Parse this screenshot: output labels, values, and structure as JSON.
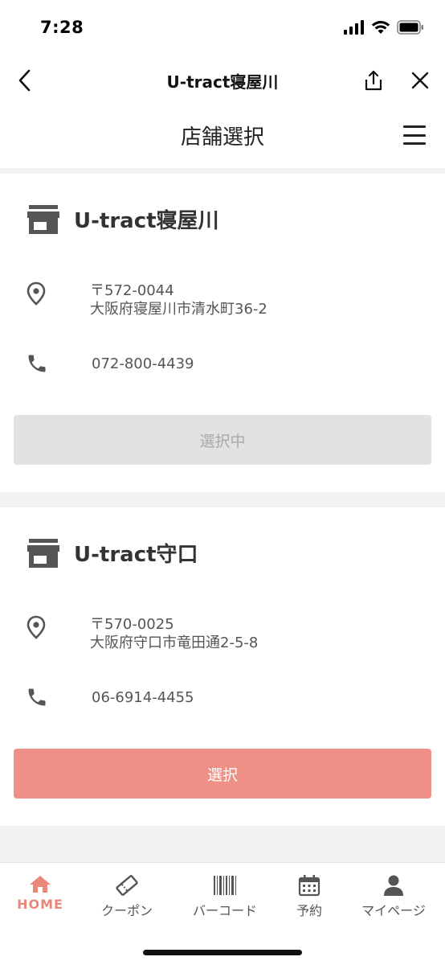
{
  "status_bar": {
    "time": "7:28"
  },
  "browser": {
    "title": "U-tract寝屋川"
  },
  "page": {
    "title": "店舗選択"
  },
  "stores": [
    {
      "name": "U-tract寝屋川",
      "postal": "〒572-0044",
      "address": "大阪府寝屋川市清水町36-2",
      "phone": "072-800-4439",
      "button_label": "選択中"
    },
    {
      "name": "U-tract守口",
      "postal": "〒570-0025",
      "address": "大阪府守口市竜田通2-5-8",
      "phone": "06-6914-4455",
      "button_label": "選択"
    }
  ],
  "tabs": [
    {
      "label": "HOME",
      "icon": "home-icon"
    },
    {
      "label": "クーポン",
      "icon": "ticket-icon"
    },
    {
      "label": "バーコード",
      "icon": "barcode-icon"
    },
    {
      "label": "予約",
      "icon": "calendar-icon"
    },
    {
      "label": "マイページ",
      "icon": "person-icon"
    }
  ],
  "colors": {
    "accent": "#ee9085",
    "home_active": "#e9877a",
    "icon_gray": "#555555"
  }
}
